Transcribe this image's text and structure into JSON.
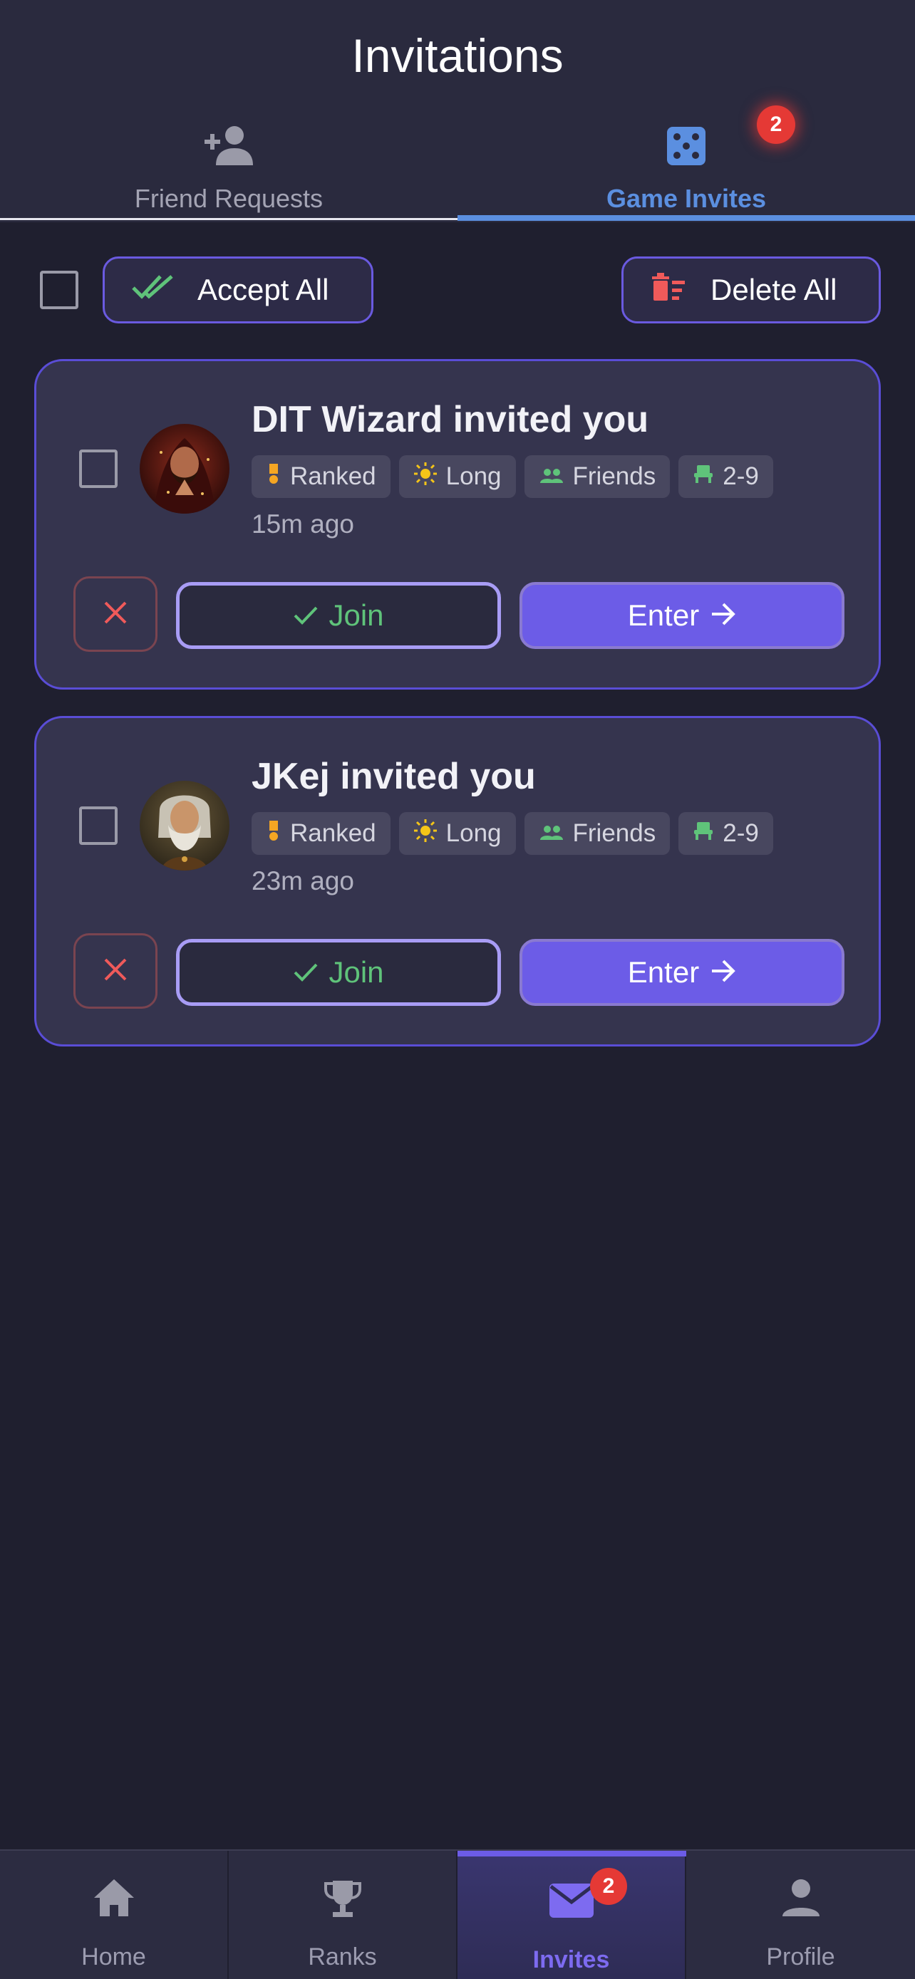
{
  "header": {
    "title": "Invitations",
    "tabs": [
      {
        "label": "Friend Requests",
        "icon": "person-add-icon",
        "active": false
      },
      {
        "label": "Game Invites",
        "icon": "dice-icon",
        "active": true,
        "badge": "2"
      }
    ]
  },
  "actions": {
    "accept_all_label": "Accept All",
    "delete_all_label": "Delete All"
  },
  "invites": [
    {
      "title": "DIT Wizard invited you",
      "chips": [
        "Ranked",
        "Long",
        "Friends",
        "2-9"
      ],
      "time_ago": "15m ago",
      "join_label": "Join",
      "enter_label": "Enter"
    },
    {
      "title": "JKej invited you",
      "chips": [
        "Ranked",
        "Long",
        "Friends",
        "2-9"
      ],
      "time_ago": "23m ago",
      "join_label": "Join",
      "enter_label": "Enter"
    }
  ],
  "bottom_nav": {
    "items": [
      {
        "label": "Home",
        "icon": "home-icon"
      },
      {
        "label": "Ranks",
        "icon": "trophy-icon"
      },
      {
        "label": "Invites",
        "icon": "mail-icon",
        "badge": "2",
        "active": true
      },
      {
        "label": "Profile",
        "icon": "person-icon"
      }
    ]
  },
  "colors": {
    "background": "#1f1f2f",
    "header": "#2a2a3e",
    "accent": "#6c5ce7",
    "tab_active": "#5b8fe0",
    "badge": "#e53935",
    "join_text": "#5fc37a",
    "decline": "#e05a5a"
  }
}
